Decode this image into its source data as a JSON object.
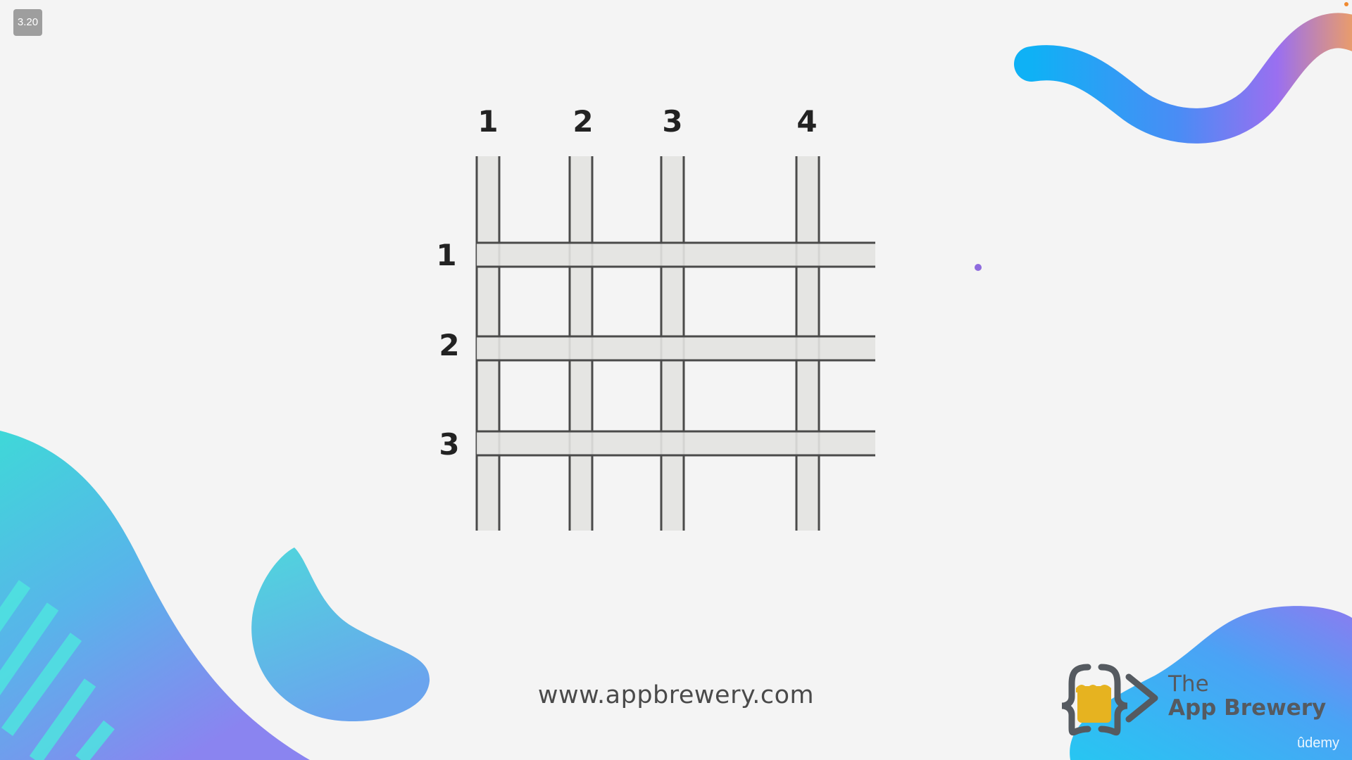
{
  "badge": "3.20",
  "grid": {
    "column_labels": [
      "1",
      "2",
      "3",
      "4"
    ],
    "row_labels": [
      "1",
      "2",
      "3"
    ]
  },
  "footer": {
    "url": "www.appbrewery.com"
  },
  "brand": {
    "line1": "The",
    "line2": "App Brewery",
    "platform": "ûdemy"
  },
  "colors": {
    "background": "#f4f4f4",
    "line_fill": "#e3e3e1",
    "line_edge": "#4a4a4a",
    "wave_start": "#0fb1f5",
    "wave_mid": "#9a6ff0",
    "wave_end": "#f0a060",
    "blob_teal": "#4dd6de",
    "blob_blue": "#5a9cf0",
    "logo_yellow": "#e6b320",
    "logo_gray": "#555a60"
  }
}
